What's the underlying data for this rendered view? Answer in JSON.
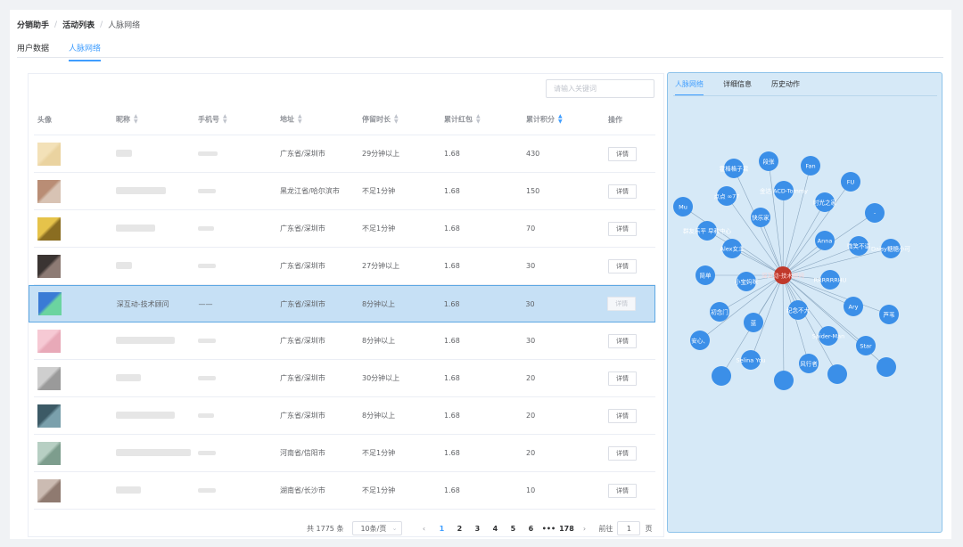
{
  "breadcrumb": [
    "分销助手",
    "活动列表",
    "人脉网络"
  ],
  "tabs": [
    {
      "label": "用户数据"
    },
    {
      "label": "人脉网络",
      "active": true
    }
  ],
  "search": {
    "placeholder": "请输入关键词"
  },
  "table": {
    "headers": [
      "头像",
      "昵称",
      "手机号",
      "地址",
      "停留时长",
      "累计红包",
      "累计积分",
      "操作"
    ],
    "rows": [
      {
        "address": "广东省/深圳市",
        "stay": "29分钟以上",
        "red": "1.68",
        "score": "430",
        "op": "详情",
        "avatar": [
          "#f3e1b8",
          "#ead3a0"
        ]
      },
      {
        "address": "黑龙江省/哈尔滨市",
        "stay": "不足1分钟",
        "red": "1.68",
        "score": "150",
        "op": "详情",
        "avatar": [
          "#b98d75",
          "#d8c3b4"
        ]
      },
      {
        "address": "广东省/深圳市",
        "stay": "不足1分钟",
        "red": "1.68",
        "score": "70",
        "op": "详情",
        "avatar": [
          "#e6c34a",
          "#8a6d21"
        ]
      },
      {
        "address": "广东省/深圳市",
        "stay": "27分钟以上",
        "red": "1.68",
        "score": "30",
        "op": "详情",
        "avatar": [
          "#3a3432",
          "#8d7b74"
        ]
      },
      {
        "nickname": "深互动-技术顾问",
        "phone": "——",
        "address": "广东省/深圳市",
        "stay": "8分钟以上",
        "red": "1.68",
        "score": "30",
        "op": "详情",
        "highlight": true,
        "avatar": [
          "#3a7bd5",
          "#6bd4a0"
        ]
      },
      {
        "address": "广东省/深圳市",
        "stay": "8分钟以上",
        "red": "1.68",
        "score": "30",
        "op": "详情",
        "avatar": [
          "#f6c9d4",
          "#e8a9b8"
        ]
      },
      {
        "address": "广东省/深圳市",
        "stay": "30分钟以上",
        "red": "1.68",
        "score": "20",
        "op": "详情",
        "avatar": [
          "#cfcfcf",
          "#9a9a9a"
        ]
      },
      {
        "address": "广东省/深圳市",
        "stay": "8分钟以上",
        "red": "1.68",
        "score": "20",
        "op": "详情",
        "avatar": [
          "#3c5a66",
          "#7aa0ac"
        ]
      },
      {
        "address": "河南省/信阳市",
        "stay": "不足1分钟",
        "red": "1.68",
        "score": "20",
        "op": "详情",
        "avatar": [
          "#b7cfc3",
          "#7d9d8d"
        ]
      },
      {
        "address": "湖南省/长沙市",
        "stay": "不足1分钟",
        "red": "1.68",
        "score": "10",
        "op": "详情",
        "avatar": [
          "#cbbbb2",
          "#8f7a70"
        ]
      }
    ]
  },
  "pagination": {
    "total": "共 1775 条",
    "page_size": "10条/页",
    "pages": [
      "1",
      "2",
      "3",
      "4",
      "5",
      "6",
      "•••",
      "178"
    ],
    "goto_label": "前往",
    "goto_value": "1",
    "page_suffix": "页"
  },
  "graph": {
    "tabs": [
      "人脉网络",
      "详细信息",
      "历史动作"
    ],
    "center": "深互动-技术顾问",
    "center_color": "#c0392b",
    "node_color": "#3b8fe8",
    "nodes": [
      "霍格格子君",
      "段张",
      "Fan",
      "FU",
      "金达 ACD-Tommy",
      "点点 ∞77",
      "时光之家",
      "Mu",
      "快乐家",
      "-",
      "Anna",
      "微笑不语",
      "群友乐平 早教中心",
      "Alex女主",
      "Daisy糖糖小可",
      "简单",
      "RRRRRRHU",
      "芦苇",
      "小宝妈咪",
      "Ary",
      "初念门",
      "蓝",
      "纪念不大",
      "Spider-Man",
      "安心、",
      "Star",
      "Selina You",
      "风行者"
    ]
  }
}
